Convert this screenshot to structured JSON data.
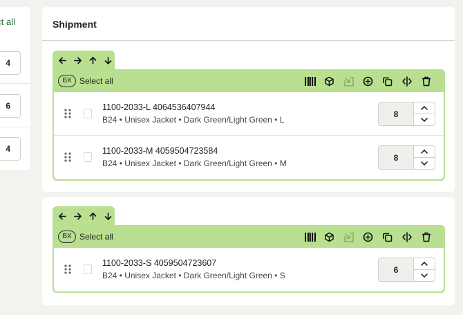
{
  "left_panel": {
    "select_all_label": "Select all",
    "quantities": [
      "4",
      "6",
      "4"
    ]
  },
  "shipment": {
    "title": "Shipment"
  },
  "toolbar": {
    "bx_badge": "BX",
    "select_all_label": "Select all",
    "icons": [
      "barcode-icon",
      "package-icon",
      "export-icon",
      "add-circle-icon",
      "duplicate-icon",
      "split-icon",
      "trash-icon"
    ],
    "arrows": [
      "arrow-left-icon",
      "arrow-right-icon",
      "arrow-up-icon",
      "arrow-down-icon"
    ]
  },
  "boxes": [
    {
      "items": [
        {
          "title": "1100-2033-L 4064536407944",
          "subtitle": "B24 • Unisex Jacket • Dark Green/Light Green • L",
          "quantity": "8"
        },
        {
          "title": "1100-2033-M 4059504723584",
          "subtitle": "B24 • Unisex Jacket • Dark Green/Light Green • M",
          "quantity": "8"
        }
      ]
    },
    {
      "items": [
        {
          "title": "1100-2033-S 4059504723607",
          "subtitle": "B24 • Unisex Jacket • Dark Green/Light Green • S",
          "quantity": "6"
        }
      ]
    }
  ],
  "colors": {
    "box_green": "#b9df91",
    "link_green": "#2e6b3c",
    "background": "#f2f2ee"
  }
}
